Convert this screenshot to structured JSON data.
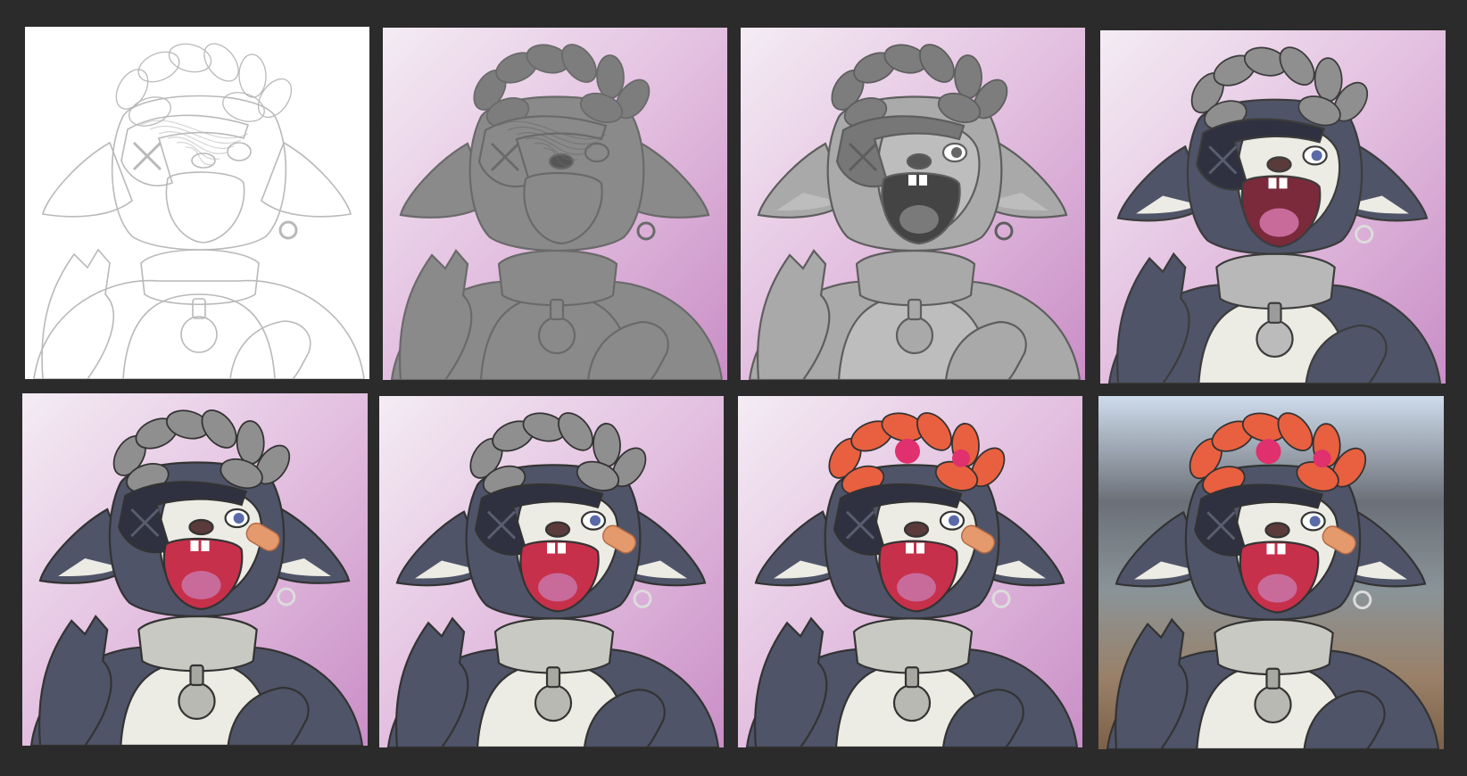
{
  "sheet": {
    "panels": [
      {
        "stage": "sketch",
        "background": "#ffffff",
        "line": "#b9b9b9",
        "fill": "none"
      },
      {
        "stage": "background-and-flat-grey",
        "background": "#e2b8df",
        "line": "#6a6a6a",
        "fill": "#8a8a8a"
      },
      {
        "stage": "grey-value-block",
        "background": "#e2b8df",
        "line": "#5e5e5e",
        "fill": "#a9a9a9"
      },
      {
        "stage": "dark-fur-and-face-render",
        "background": "#e2b8df",
        "line": "#3c3c3c",
        "fill": "#9b9b9b"
      },
      {
        "stage": "body-render",
        "background": "#e0b6dc",
        "line": "#333333",
        "fill": "#53586d"
      },
      {
        "stage": "refined-render",
        "background": "#e1b7dd",
        "line": "#333333",
        "fill": "#53586d"
      },
      {
        "stage": "flower-crown-color",
        "background": "#e2b8df",
        "line": "#333333",
        "fill": "#53586d"
      },
      {
        "stage": "final-with-photo-background",
        "background": "#8e8a84",
        "line": "#333333",
        "fill": "#53586d"
      }
    ],
    "colors": {
      "frame": "#2b2b2b",
      "dark_fur": "#4f5468",
      "white_fur": "#ecebe4",
      "mouth": "#c7304a",
      "tongue": "#c86b9a",
      "bandaid": "#e49a6c",
      "flowers": "#e8603f",
      "flower_pink": "#e0306e",
      "collar": "#c9c9c3"
    }
  }
}
